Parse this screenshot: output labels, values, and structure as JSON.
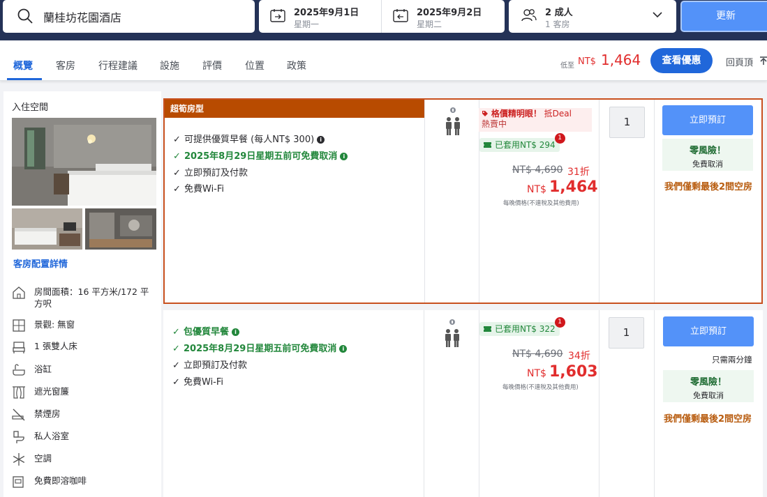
{
  "search": {
    "destination": "蘭桂坊花園酒店",
    "checkin_date": "2025年9月1日",
    "checkin_day": "星期一",
    "checkout_date": "2025年9月2日",
    "checkout_day": "星期二",
    "guests": "2 成人",
    "rooms": "1 客房",
    "update_label": "更新"
  },
  "nav": {
    "tabs": [
      "概覽",
      "客房",
      "行程建議",
      "設施",
      "評價",
      "位置",
      "政策"
    ],
    "lowest_label": "低至",
    "lowest_currency": "NT$",
    "lowest_price": "1,464",
    "view_deal_label": "查看優惠",
    "back_top_label": "回頁頂"
  },
  "room": {
    "section_title": "入住空間",
    "details_link": "客房配置詳情",
    "features": [
      "房間面積：16 平方米/172 平方呎",
      "景觀: 無窗",
      "1 張雙人床",
      "浴缸",
      "遮光窗簾",
      "禁煙房",
      "私人浴室",
      "空調",
      "免費即溶咖啡"
    ]
  },
  "offers": [
    {
      "banner": "超筍房型",
      "benefits": [
        "可提供優質早餐 (每人NT$ 300)",
        "2025年8月29日星期五前可免費取消",
        "立即預訂及付款",
        "免費Wi-Fi"
      ],
      "alert_title": "格價精明眼！",
      "alert_extra": "抵Deal",
      "alert_sub": "熱賣中",
      "coupon": "已套用NT$ 294",
      "coupon_badge": "1",
      "original_price": "NT$ 4,690",
      "discount": "31折",
      "currency": "NT$",
      "price": "1,464",
      "price_note": "每晚價格(不連稅及其他費用)",
      "quantity": "1",
      "book_label": "立即預訂",
      "zero_risk": "零風險！",
      "free_cancel": "免費取消",
      "last_rooms": "我們僅剩最後2間空房"
    },
    {
      "benefits": [
        "包優質早餐",
        "2025年8月29日星期五前可免費取消",
        "立即預訂及付款",
        "免費Wi-Fi"
      ],
      "coupon": "已套用NT$ 322",
      "coupon_badge": "1",
      "original_price": "NT$ 4,690",
      "discount": "34折",
      "currency": "NT$",
      "price": "1,603",
      "price_note": "每晚價格(不連稅及其他費用)",
      "quantity": "1",
      "book_label": "立即預訂",
      "booking_time": "只需兩分鐘",
      "zero_risk": "零風險！",
      "free_cancel": "免費取消",
      "last_rooms": "我們僅剩最後2間空房"
    }
  ],
  "icons": [
    "search-icon",
    "calendar-checkin-icon",
    "calendar-checkout-icon",
    "people-icon",
    "chevron-down-icon",
    "arrow-up-icon",
    "info-icon",
    "occupancy-icon",
    "price-tag-icon",
    "ticket-icon"
  ],
  "colors": {
    "header_bg": "#243257",
    "accent": "#2067da",
    "button": "#5392f9",
    "price_red": "#e12d2d",
    "banner": "#b84b00",
    "green": "#22873b"
  }
}
